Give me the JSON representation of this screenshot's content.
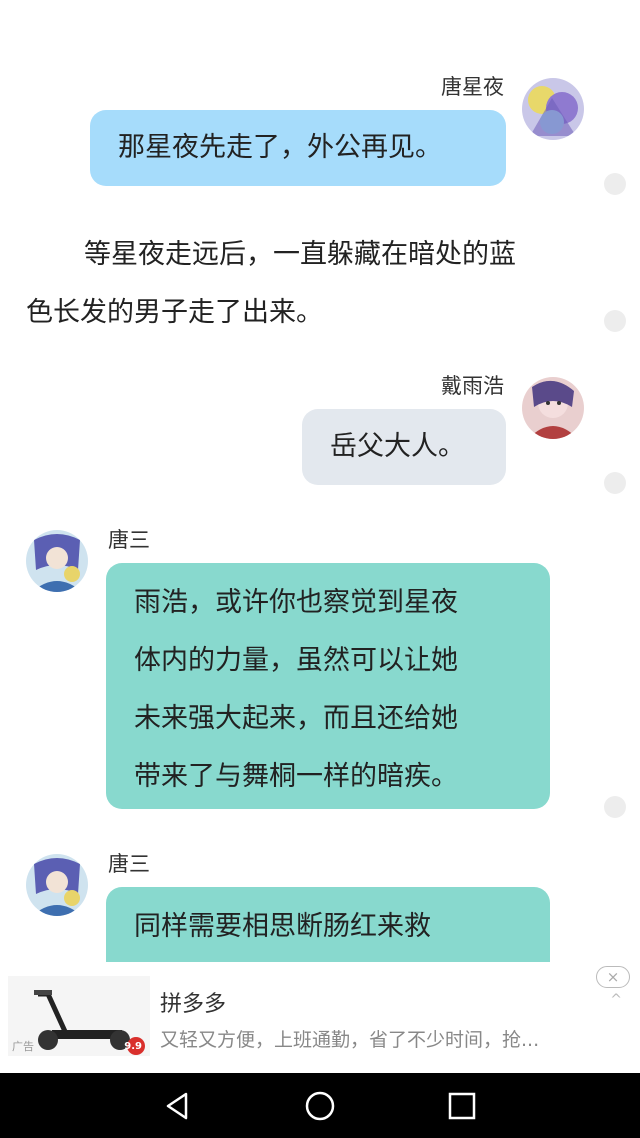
{
  "messages": [
    {
      "speaker": "唐星夜",
      "text": "那星夜先走了，外公再见。"
    },
    {
      "speaker": "戴雨浩",
      "text": "岳父大人。"
    },
    {
      "speaker": "唐三",
      "lines": [
        "雨浩，或许你也察觉到星夜",
        "体内的力量，虽然可以让她",
        "未来强大起来，而且还给她",
        "带来了与舞桐一样的暗疾。"
      ]
    },
    {
      "speaker": "唐三",
      "text": "同样需要相思断肠红来救"
    }
  ],
  "narration": {
    "line1": "等星夜走远后，一直躲藏在暗处的蓝",
    "line2": "色长发的男子走了出来。"
  },
  "ad": {
    "title": "拼多多",
    "description": "又轻又方便，上班通勤，省了不少时间，抢...",
    "tag": "广告",
    "price": "9.9",
    "close_icon": "×",
    "collapse_icon": "^"
  },
  "colors": {
    "bubble_blue": "#a6dcfb",
    "bubble_gray": "#e3e8ee",
    "bubble_teal": "#88d9ce"
  }
}
